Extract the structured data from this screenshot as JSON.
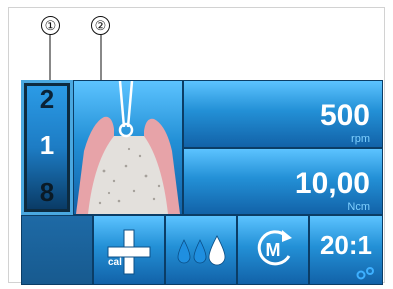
{
  "callouts": [
    "①",
    "②"
  ],
  "program": {
    "top_digit": "2",
    "middle_digit": "1",
    "bottom_digit": "8"
  },
  "speed": {
    "value": "500",
    "unit": "rpm"
  },
  "torque": {
    "value": "10,00",
    "unit": "Ncm"
  },
  "toolbar": {
    "calibrate_label": "cal",
    "ratio_label": "20:1",
    "motor_letter": "M"
  },
  "icons": [
    "bone-implant-icon",
    "calibrate-icon",
    "irrigation-icon",
    "motor-rotation-icon",
    "gear-icon"
  ],
  "colors": {
    "panel_blue": "#2390d6",
    "panel_dark": "#0f3a5a",
    "unit_text": "#7fd0ff",
    "gum_pink": "#e7a3a8",
    "bone_grey": "#e3e0dc",
    "drop_blue": "#1f8fe0"
  }
}
